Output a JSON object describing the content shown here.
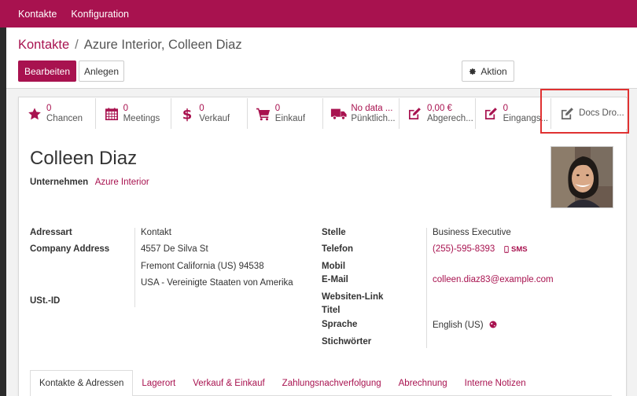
{
  "navbar": {
    "items": [
      "Kontakte",
      "Konfiguration"
    ]
  },
  "breadcrumb": {
    "parent": "Kontakte",
    "separator": "/",
    "current": "Azure Interior, Colleen Diaz"
  },
  "toolbar": {
    "edit_label": "Bearbeiten",
    "create_label": "Anlegen",
    "action_label": "Aktion"
  },
  "smart_buttons": [
    {
      "icon": "star-icon",
      "value": "0",
      "label": "Chancen"
    },
    {
      "icon": "calendar-icon",
      "value": "0",
      "label": "Meetings"
    },
    {
      "icon": "dollar-icon",
      "value": "0",
      "label": "Verkauf"
    },
    {
      "icon": "cart-icon",
      "value": "0",
      "label": "Einkauf"
    },
    {
      "icon": "truck-icon",
      "value": "No data ...",
      "label": "Pünktlich..."
    },
    {
      "icon": "edit-icon",
      "value": "0,00 €",
      "label": "Abgerech..."
    },
    {
      "icon": "edit-icon",
      "value": "0",
      "label": "Eingangs..."
    },
    {
      "icon": "edit-icon",
      "value": "",
      "label": "Docs Dro..."
    }
  ],
  "partner": {
    "name": "Colleen Diaz",
    "company_label": "Unternehmen",
    "company_value": "Azure Interior"
  },
  "left_fields": {
    "address_type_label": "Adressart",
    "address_type_value": "Kontakt",
    "company_address_label": "Company Address",
    "street": "4557 De Silva St",
    "city_line": "Fremont  California (US)  94538",
    "country": "USA - Vereinigte Staaten von Amerika",
    "vat_label": "USt.-ID"
  },
  "right_fields": {
    "job_label": "Stelle",
    "job_value": "Business Executive",
    "phone_label": "Telefon",
    "phone_value": "(255)-595-8393",
    "sms_label": "SMS",
    "mobile_label": "Mobil",
    "email_label": "E-Mail",
    "email_value": "colleen.diaz83@example.com",
    "website_label": "Websiten-Link",
    "title_label": "Titel",
    "language_label": "Sprache",
    "language_value": "English (US)",
    "tags_label": "Stichwörter"
  },
  "tabs": [
    {
      "label": "Kontakte & Adressen",
      "active": true
    },
    {
      "label": "Lagerort",
      "active": false
    },
    {
      "label": "Verkauf & Einkauf",
      "active": false
    },
    {
      "label": "Zahlungsnachverfolgung",
      "active": false
    },
    {
      "label": "Abrechnung",
      "active": false
    },
    {
      "label": "Interne Notizen",
      "active": false
    }
  ],
  "colors": {
    "brand": "#a8124f",
    "highlight": "#e03131"
  }
}
